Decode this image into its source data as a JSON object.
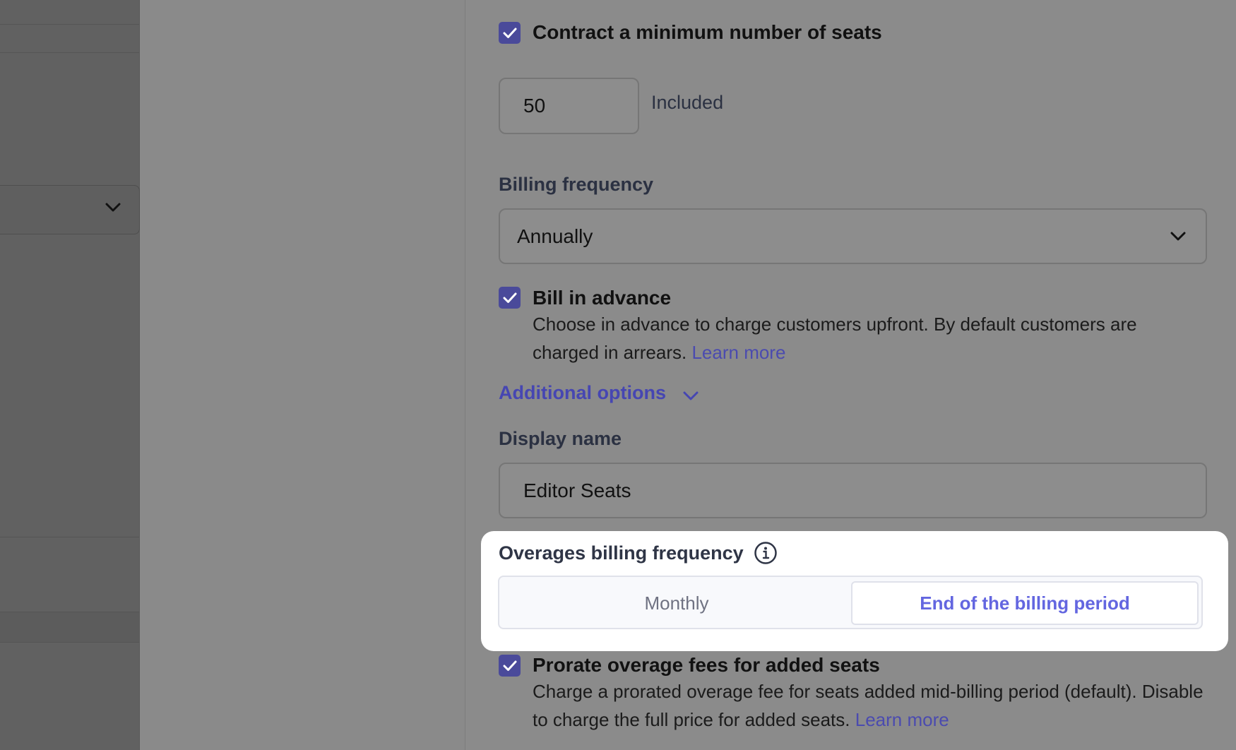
{
  "form": {
    "min_seats": {
      "label": "Contract a minimum number of seats",
      "checked": true,
      "value": "50",
      "suffix": "Included"
    },
    "billing_frequency": {
      "label": "Billing frequency",
      "selected": "Annually"
    },
    "bill_in_advance": {
      "label": "Bill in advance",
      "checked": true,
      "help": "Choose in advance to charge customers upfront. By default customers are charged in arrears.",
      "link": "Learn more"
    },
    "additional_options": {
      "label": "Additional options",
      "icon": "chevron-down-icon"
    },
    "display_name": {
      "label": "Display name",
      "value": "Editor Seats"
    },
    "overages": {
      "label": "Overages billing frequency",
      "info_icon": "info-icon",
      "options": [
        "Monthly",
        "End of the billing period"
      ],
      "selected": "End of the billing period"
    },
    "prorate": {
      "label": "Prorate overage fees for added seats",
      "checked": true,
      "help": "Charge a prorated overage fee for seats added mid-billing period (default). Disable to charge the full price for added seats.",
      "link": "Learn more"
    }
  },
  "colors": {
    "accent": "#6366e0",
    "checkbox": "#4a4a9a",
    "link": "#4b4baf"
  }
}
